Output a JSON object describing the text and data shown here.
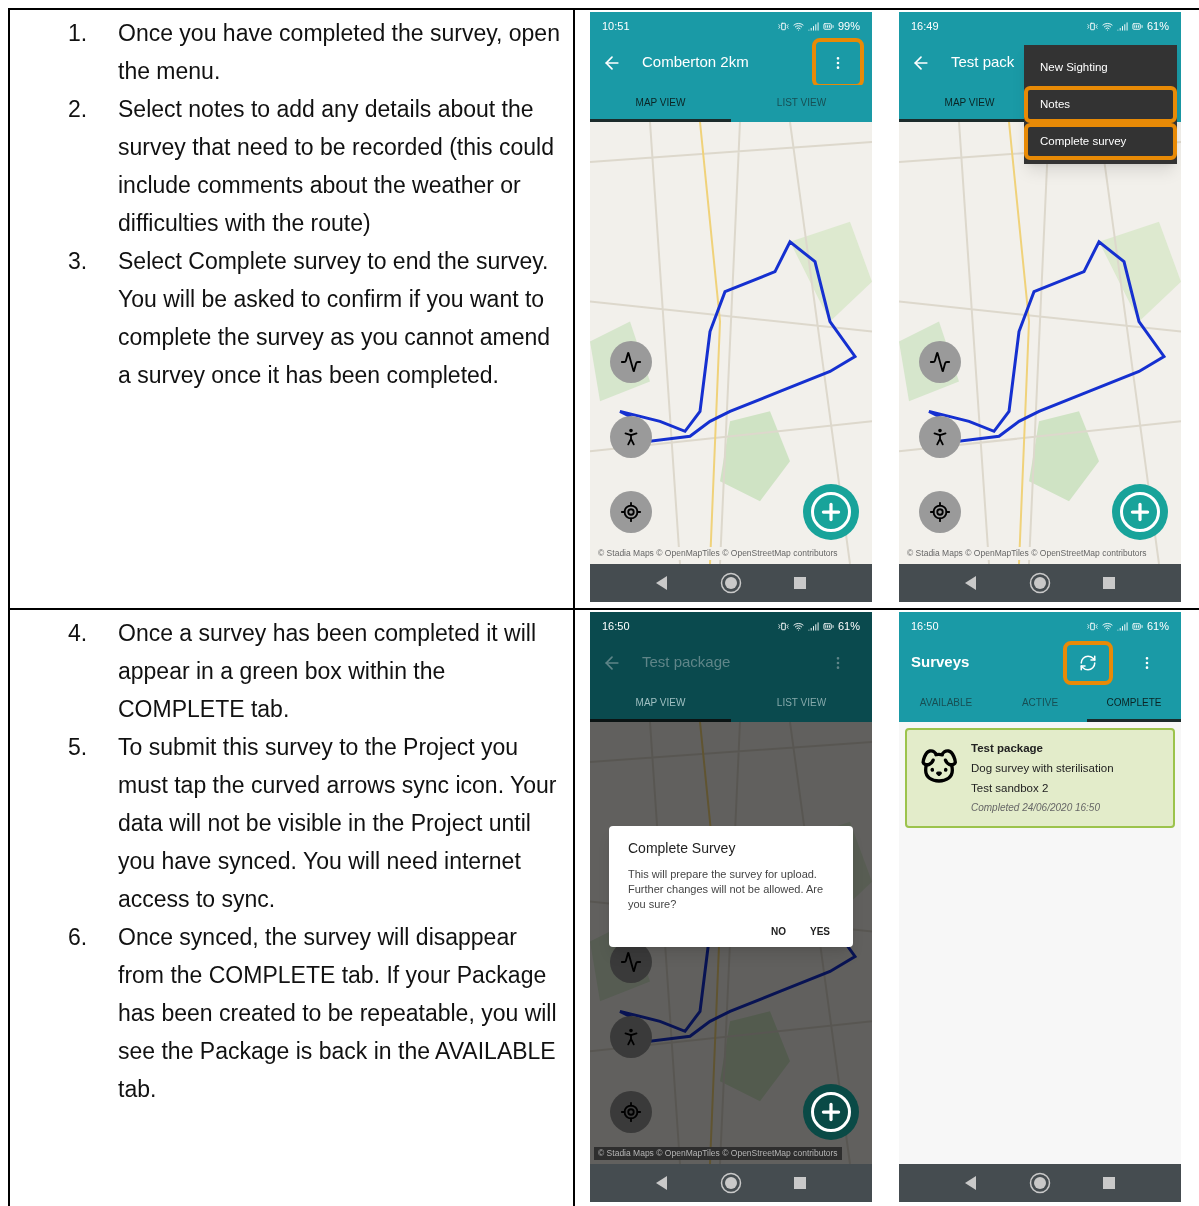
{
  "rows": [
    {
      "steps": [
        {
          "number": "1.",
          "text": "Once you have completed the survey, open the menu."
        },
        {
          "number": "2.",
          "text": "Select notes to add any details about the survey that need to be recorded (this could include comments about the weather or difficulties with the route)"
        },
        {
          "number": "3.",
          "text": "Select Complete survey to end the survey. You will be asked to confirm if you want to complete the survey as you cannot amend a survey once it has been completed."
        }
      ],
      "phones": [
        {
          "kind": "map",
          "time": "10:51",
          "battery": "99%",
          "title": "Comberton 2km",
          "dimmed": false,
          "menu_highlighted": true,
          "tabs": [
            {
              "label": "MAP VIEW",
              "selected": true
            },
            {
              "label": "LIST VIEW",
              "selected": false
            }
          ],
          "attribution": "© Stadia Maps © OpenMapTiles © OpenStreetMap contributors"
        },
        {
          "kind": "map",
          "time": "16:49",
          "battery": "61%",
          "title": "Test pack",
          "dimmed": false,
          "tabs": [
            {
              "label": "MAP VIEW",
              "selected": true
            }
          ],
          "attribution": "© Stadia Maps © OpenMapTiles © OpenStreetMap contributors",
          "menu": [
            {
              "label": "New Sighting",
              "highlighted": false
            },
            {
              "label": "Notes",
              "highlighted": true
            },
            {
              "label": "Complete survey",
              "highlighted": true
            }
          ]
        }
      ]
    },
    {
      "steps": [
        {
          "number": "4.",
          "text": "Once a survey has been completed it will appear in a green box within the COMPLETE tab."
        },
        {
          "number": "5.",
          "text": "To submit this survey to the Project you must tap the curved arrows sync icon. Your data will not be visible in the Project until you have synced. You will need internet access to sync."
        },
        {
          "number": "6.",
          "text": "Once synced, the survey will disappear from the COMPLETE tab. If your Package has been created to be repeatable, you will see the Package is back in the AVAILABLE tab."
        }
      ],
      "phones": [
        {
          "kind": "map",
          "time": "16:50",
          "battery": "61%",
          "title": "Test package",
          "dimmed": true,
          "menu_highlighted": false,
          "tabs": [
            {
              "label": "MAP VIEW",
              "selected": true
            },
            {
              "label": "LIST VIEW",
              "selected": false
            }
          ],
          "attribution": "© Stadia Maps © OpenMapTiles © OpenStreetMap contributors",
          "dialog": {
            "title": "Complete Survey",
            "body": "This will prepare the survey for upload. Further changes will not be allowed. Are you sure?",
            "buttons": [
              "NO",
              "YES"
            ]
          }
        },
        {
          "kind": "list",
          "time": "16:50",
          "battery": "61%",
          "title": "Surveys",
          "sync_highlighted": true,
          "menu_highlighted": false,
          "tabs": [
            {
              "label": "AVAILABLE",
              "selected": false
            },
            {
              "label": "ACTIVE",
              "selected": false
            },
            {
              "label": "COMPLETE",
              "selected": true
            }
          ],
          "card": {
            "title": "Test package",
            "lines": [
              "Dog survey with sterilisation",
              "Test sandbox 2"
            ],
            "completed": "Completed 24/06/2020 16:50"
          }
        }
      ]
    }
  ]
}
